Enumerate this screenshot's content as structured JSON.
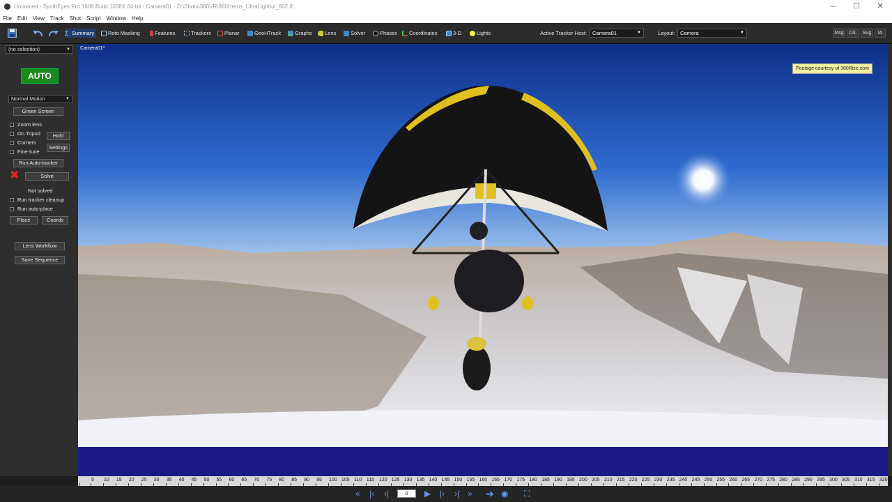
{
  "window": {
    "title": "Unnamed - SynthEyes Pro 1608 Build 1038X 64-bit - Camera01 - D:\\Shots\\360VR\\360Heros_UltraLight\\ul_802.ifl"
  },
  "menu": [
    "File",
    "Edit",
    "View",
    "Track",
    "Shot",
    "Script",
    "Window",
    "Help"
  ],
  "toolbar": {
    "tabs": [
      {
        "label": "Summary",
        "icon": "sigma-icon"
      },
      {
        "label": "Roto Masking",
        "icon": "roto-icon"
      },
      {
        "label": "Features",
        "icon": "features-icon"
      },
      {
        "label": "Trackers",
        "icon": "trackers-icon"
      },
      {
        "label": "Planar",
        "icon": "planar-icon"
      },
      {
        "label": "GeoHTrack",
        "icon": "geoh-icon"
      },
      {
        "label": "Graphs",
        "icon": "graphs-icon"
      },
      {
        "label": "Lens",
        "icon": "lens-icon"
      },
      {
        "label": "Solver",
        "icon": "solver-icon"
      },
      {
        "label": "Phases",
        "icon": "phases-icon"
      },
      {
        "label": "Coordinates",
        "icon": "coordinates-icon"
      },
      {
        "label": "3-D",
        "icon": "cube-icon"
      },
      {
        "label": "Lights",
        "icon": "bulb-icon"
      }
    ],
    "active_tracker_host_label": "Active Tracker Host:",
    "active_tracker_host_value": "Camera01",
    "layout_label": "Layout:",
    "layout_value": "Camera",
    "right_buttons": [
      "Msg",
      "D/L",
      "Sug",
      "IA"
    ]
  },
  "panel": {
    "selection": "(no selection)",
    "auto_label": "AUTO",
    "motion_type": "Normal Motion",
    "green_screen": "Green Screen",
    "checks": [
      {
        "label": "Zoom lens",
        "checked": false
      },
      {
        "label": "On Tripod",
        "checked": false
      },
      {
        "label": "Corners",
        "checked": false
      },
      {
        "label": "Fine-tune",
        "checked": false
      }
    ],
    "hold": "Hold",
    "settings": "Settings",
    "run_auto_tracker": "Run Auto-tracker",
    "solve": "Solve",
    "status": "Not solved",
    "run_tracker_cleanup": "Run tracker cleanup",
    "run_auto_place": "Run auto-place",
    "place": "Place",
    "coords": "Coords",
    "lens_workflow": "Lens Workflow",
    "save_sequence": "Save Sequence"
  },
  "viewport": {
    "camera_label": "Camera01*",
    "footage_note": "Footage courtesy of 360Rize.com"
  },
  "timeline": {
    "ticks": [
      "5",
      "10",
      "15",
      "20",
      "25",
      "30",
      "35",
      "40",
      "45",
      "50",
      "55",
      "60",
      "65",
      "70",
      "75",
      "80",
      "85",
      "90",
      "95",
      "100",
      "105",
      "110",
      "115",
      "120",
      "125",
      "130",
      "135",
      "140",
      "145",
      "150",
      "155",
      "160",
      "165",
      "170",
      "175",
      "180",
      "185",
      "190",
      "195",
      "200",
      "205",
      "210",
      "215",
      "220",
      "225",
      "230",
      "235",
      "240",
      "245",
      "250",
      "255",
      "260",
      "265",
      "270",
      "275",
      "280",
      "285",
      "290",
      "295",
      "300",
      "305",
      "310",
      "315",
      "320"
    ]
  },
  "playback": {
    "frame": "0"
  }
}
